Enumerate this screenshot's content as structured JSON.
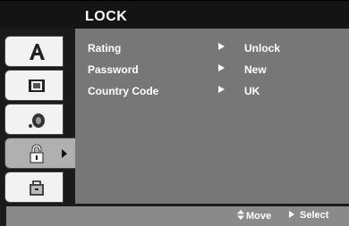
{
  "header": {
    "title": "LOCK"
  },
  "sidebar": {
    "tabs": [
      {
        "icon": "language-letter-a-icon",
        "selected": false
      },
      {
        "icon": "display-screen-icon",
        "selected": false
      },
      {
        "icon": "audio-speaker-icon",
        "selected": false
      },
      {
        "icon": "padlock-icon",
        "selected": true
      },
      {
        "icon": "others-bag-icon",
        "selected": false
      }
    ]
  },
  "menu": {
    "rows": [
      {
        "label": "Rating",
        "value": "Unlock"
      },
      {
        "label": "Password",
        "value": "New"
      },
      {
        "label": "Country Code",
        "value": "UK"
      }
    ]
  },
  "footer": {
    "move_label": "Move",
    "select_label": "Select",
    "move_icon": "up-down-arrows-icon",
    "select_icon": "right-triangle-icon"
  },
  "colors": {
    "title_bar": "#141414",
    "panel": "#777777",
    "footer": "#8a8a8a",
    "selected_tab": "#b0b0b0",
    "tab": "#f2f2f2",
    "text": "#ffffff"
  }
}
